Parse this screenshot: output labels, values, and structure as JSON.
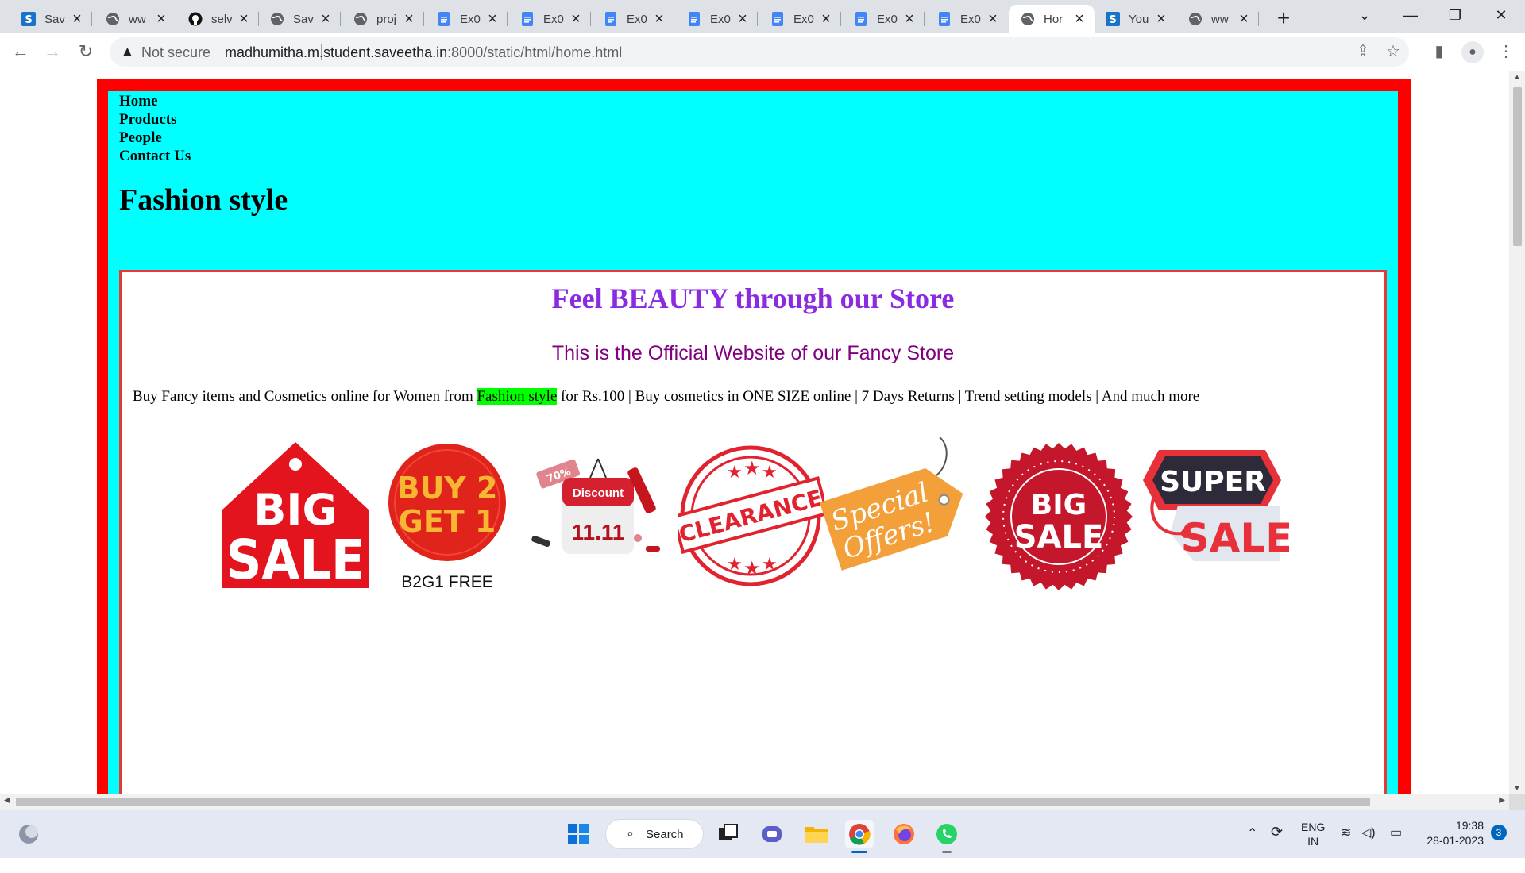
{
  "browser": {
    "tabs": [
      {
        "title": "Sav",
        "icon": "saveetha-s-icon",
        "active": false
      },
      {
        "title": "ww",
        "icon": "globe-icon",
        "active": false
      },
      {
        "title": "selv",
        "icon": "github-icon",
        "active": false
      },
      {
        "title": "Sav",
        "icon": "globe-icon",
        "active": false
      },
      {
        "title": "proj",
        "icon": "globe-icon",
        "active": false
      },
      {
        "title": "Ex0",
        "icon": "docs-icon",
        "active": false
      },
      {
        "title": "Ex0",
        "icon": "docs-icon",
        "active": false
      },
      {
        "title": "Ex0",
        "icon": "docs-icon",
        "active": false
      },
      {
        "title": "Ex0",
        "icon": "docs-icon",
        "active": false
      },
      {
        "title": "Ex0",
        "icon": "docs-icon",
        "active": false
      },
      {
        "title": "Ex0",
        "icon": "docs-icon",
        "active": false
      },
      {
        "title": "Ex0",
        "icon": "docs-icon",
        "active": false
      },
      {
        "title": "Hor",
        "icon": "globe-icon",
        "active": true
      },
      {
        "title": "You",
        "icon": "saveetha-s-icon",
        "active": false
      },
      {
        "title": "ww",
        "icon": "globe-icon",
        "active": false
      }
    ],
    "new_tab_label": "+",
    "address": {
      "security_label": "Not secure",
      "url_host": "madhumitha.m.student.saveetha.in",
      "url_rest": ":8000/static/html/home.html"
    }
  },
  "page": {
    "nav": [
      "Home",
      "Products",
      "People",
      "Contact Us"
    ],
    "site_title": "Fashion style",
    "headline": "Feel BEAUTY through our Store",
    "subheadline": "This is the Official Website of our Fancy Store",
    "description": {
      "before": "Buy Fancy items and Cosmetics online for Women from ",
      "highlight": "Fashion style",
      "after": " for Rs.100 | Buy cosmetics in ONE SIZE online | 7 Days Returns | Trend setting models | And much more"
    },
    "badges": {
      "big_sale_1": [
        "BIG",
        "SALE"
      ],
      "buy2get1": [
        "BUY 2",
        "GET 1"
      ],
      "buy2get1_caption": "B2G1 FREE",
      "discount": {
        "tag": "70%",
        "title": "Discount",
        "date": "11.11"
      },
      "clearance": "CLEARANCE",
      "special_offers": [
        "Special",
        "Offers!"
      ],
      "big_sale_2": [
        "BIG",
        "SALE"
      ],
      "super_sale": [
        "SUPER",
        "SALE"
      ]
    }
  },
  "taskbar": {
    "search_label": "Search",
    "language": [
      "ENG",
      "IN"
    ],
    "time": "19:38",
    "date": "28-01-2023",
    "notification_count": "3"
  },
  "colors": {
    "frame_red": "#ff0000",
    "cyan_bg": "#00ffff",
    "headline_purple": "#8a2be2",
    "subline_purple": "#800080",
    "highlight_green": "#00ff00"
  }
}
